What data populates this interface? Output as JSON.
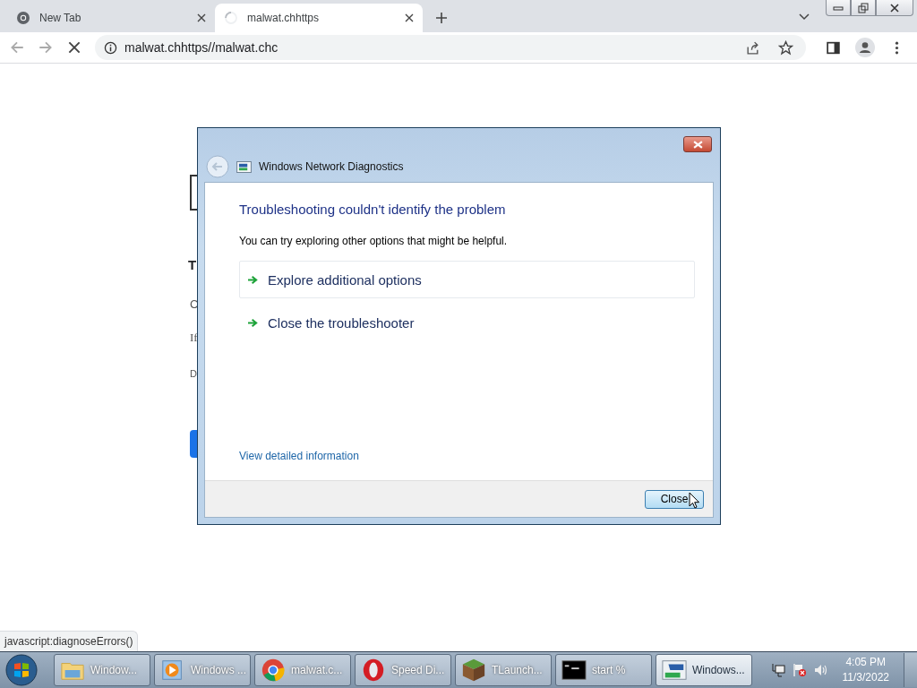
{
  "browser": {
    "tabs": [
      {
        "title": "New Tab",
        "selected": false,
        "loading": false
      },
      {
        "title": "malwat.chhttps",
        "selected": true,
        "loading": true
      }
    ],
    "address": "malwat.chhttps//malwat.chc"
  },
  "page": {
    "fragments": [
      "T",
      "C",
      "If",
      "D"
    ]
  },
  "status_bubble": "javascript:diagnoseErrors()",
  "dialog": {
    "title": "Windows Network Diagnostics",
    "heading": "Troubleshooting couldn't identify the problem",
    "message": "You can try exploring other options that might be helpful.",
    "options": [
      {
        "label": "Explore additional options",
        "highlighted": true
      },
      {
        "label": "Close the troubleshooter",
        "highlighted": false
      }
    ],
    "link": "View detailed information",
    "button": "Close"
  },
  "taskbar": {
    "items": [
      {
        "label": "Window...",
        "kind": "folder",
        "selected": false
      },
      {
        "label": "Windows ...",
        "kind": "media",
        "selected": false
      },
      {
        "label": "malwat.c...",
        "kind": "chrome",
        "selected": false
      },
      {
        "label": "Speed Di...",
        "kind": "opera",
        "selected": false
      },
      {
        "label": "TLaunch...",
        "kind": "block",
        "selected": false
      },
      {
        "label": "start  %",
        "kind": "console",
        "selected": false
      },
      {
        "label": "Windows...",
        "kind": "diagnostics",
        "selected": true
      }
    ],
    "time": "4:05 PM",
    "date": "11/3/2022"
  }
}
